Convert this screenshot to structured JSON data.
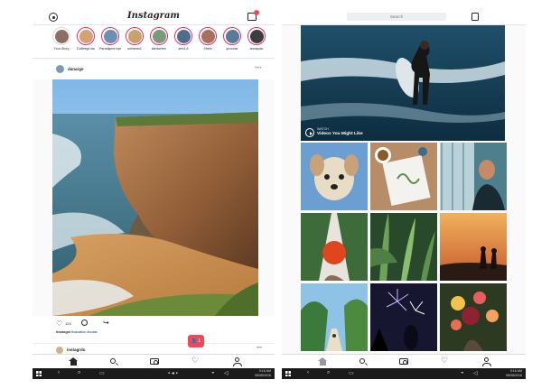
{
  "feed": {
    "app_title": "Instagram",
    "stories": [
      {
        "name": "Your Story",
        "color": "#8d6e63",
        "seen": true
      },
      {
        "name": "Coffeegrl.we",
        "color": "#d4a373"
      },
      {
        "name": "Paradigme.inps",
        "color": "#6d8fb3"
      },
      {
        "name": "unhanes1",
        "color": "#c9a26b"
      },
      {
        "name": "kamisreen",
        "color": "#7c9a7a"
      },
      {
        "name": "ann1.8",
        "color": "#4f6d8a"
      },
      {
        "name": "Sheln",
        "color": "#a86f5d"
      },
      {
        "name": "juronnie",
        "color": "#5a7a9a"
      },
      {
        "name": "annapolo",
        "color": "#3d3d3d"
      }
    ],
    "post": {
      "username": "danarge",
      "more": "•••",
      "likes": "124",
      "caption_user": "instargm",
      "caption_text": "#vacation #coast"
    },
    "next_post": {
      "username": "instagrdu",
      "more": "•••"
    },
    "notification": {
      "count": "1"
    }
  },
  "explore": {
    "search_placeholder": "Search",
    "video": {
      "overline": "WATCH",
      "title": "Videos You Might Like"
    }
  },
  "taskbar": {
    "left": {
      "time": "9:16 AM",
      "date": "06/08/2016"
    },
    "right": {
      "time": "9:16 AM",
      "date": "06/08/2016"
    }
  },
  "colors": {
    "accent": "#ed4956",
    "story_ring": "#e1306c",
    "taskbar": "#1b1b1b"
  }
}
